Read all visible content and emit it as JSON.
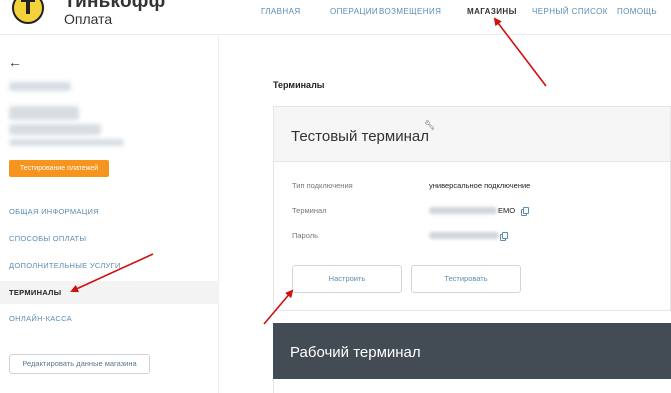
{
  "header": {
    "logo": {
      "line1": "Тинькофф",
      "line2": "Оплата"
    },
    "nav": [
      {
        "label": "ГЛАВНАЯ",
        "active": false
      },
      {
        "label": "ОПЕРАЦИИ",
        "active": false
      },
      {
        "label": "ВОЗМЕЩЕНИЯ",
        "active": false
      },
      {
        "label": "МАГАЗИНЫ",
        "active": true
      },
      {
        "label": "ЧЕРНЫЙ СПИСОК",
        "active": false
      },
      {
        "label": "ПОМОЩЬ",
        "active": false
      }
    ]
  },
  "sidebar": {
    "back": "←",
    "test_payments_label": "Тестирование платежей",
    "items": [
      {
        "label": "ОБЩАЯ ИНФОРМАЦИЯ",
        "active": false
      },
      {
        "label": "СПОСОБЫ ОПЛАТЫ",
        "active": false
      },
      {
        "label": "ДОПОЛНИТЕЛЬНЫЕ УСЛУГИ",
        "active": false
      },
      {
        "label": "ТЕРМИНАЛЫ",
        "active": true
      },
      {
        "label": "ОНЛАЙН-КАССА",
        "active": false
      }
    ],
    "edit_store_label": "Редактировать данные магазина"
  },
  "main": {
    "title": "Терминалы",
    "test_terminal": {
      "title": "Тестовый терминал",
      "fields": [
        {
          "label": "Тип подключения",
          "value": "универсальное подключение"
        },
        {
          "label": "Терминал",
          "value": "EMO"
        },
        {
          "label": "Пароль",
          "value": ""
        }
      ],
      "configure_label": "Настроить",
      "test_label": "Тестировать"
    },
    "work_terminal": {
      "title": "Рабочий терминал"
    }
  },
  "colors": {
    "accent_orange": "#f7941d",
    "link_blue": "#5b8db3",
    "dark_card": "#434b55",
    "annotation_red": "#d01010"
  }
}
